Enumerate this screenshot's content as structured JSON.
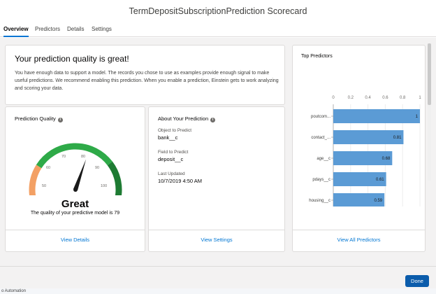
{
  "modal": {
    "title": "TermDepositSubscriptionPrediction Scorecard"
  },
  "tabs": [
    {
      "label": "Overview"
    },
    {
      "label": "Predictors"
    },
    {
      "label": "Details"
    },
    {
      "label": "Settings"
    }
  ],
  "summary": {
    "heading": "Your prediction quality is great!",
    "body": "You have enough data to support a model. The records you chose to use as examples provide enough signal to make useful predictions. We recommend enabling this prediction. When you enable a prediction, Einstein gets to work analyzing and scoring your data."
  },
  "quality": {
    "title": "Prediction Quality",
    "gauge_value": 79,
    "gauge_ticks": [
      "50",
      "60",
      "70",
      "80",
      "90",
      "100"
    ],
    "rating": "Great",
    "caption": "The quality of your predictive model is 79",
    "link": "View Details",
    "colors": {
      "low": "#f3a064",
      "mid": "#2eaa48",
      "high": "#1e7b33",
      "danger": "#d4273d",
      "needle": "#1a1a1a"
    }
  },
  "about": {
    "title": "About Your Prediction",
    "object_label": "Object to Predict",
    "object_value": "bank__c",
    "field_label": "Field to Predict",
    "field_value": "deposit__c",
    "updated_label": "Last Updated",
    "updated_value": "10/7/2019 4:50 AM",
    "link": "View Settings"
  },
  "predictors": {
    "title": "Top Predictors",
    "link": "View All Predictors",
    "bar_color": "#5b9bd5"
  },
  "chart_data": {
    "type": "bar",
    "orientation": "horizontal",
    "categories": [
      "poutcom...",
      "contact_...",
      "age__c",
      "pdays__c",
      "housing__c"
    ],
    "values": [
      1,
      0.81,
      0.68,
      0.61,
      0.59
    ],
    "value_labels": [
      "1",
      "0.81",
      "0.68",
      "0.61",
      "0.59"
    ],
    "xticks": [
      "0",
      "0.2",
      "0.4",
      "0.6",
      "0.8",
      "1"
    ],
    "xlim": [
      0,
      1
    ],
    "tick_position": "top"
  },
  "footer": {
    "done_label": "Done"
  },
  "background": {
    "text": "o Automation"
  }
}
